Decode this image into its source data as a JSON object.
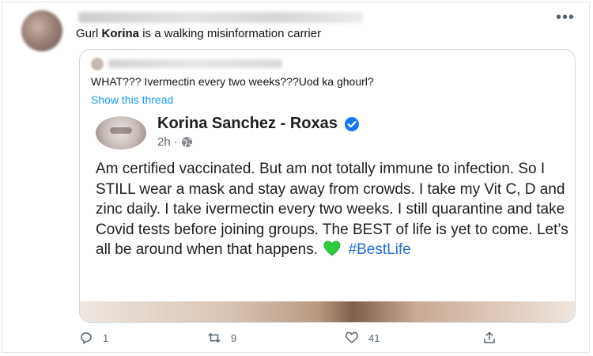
{
  "tweet": {
    "text_prefix": "Gurl ",
    "text_bold": "Korina",
    "text_suffix": " is a walking misinformation carrier"
  },
  "quote": {
    "text": "WHAT??? Ivermectin every two weeks???Uod ka ghourl?",
    "show_thread": "Show this thread"
  },
  "fb_post": {
    "author": "Korina Sanchez - Roxas",
    "time": "2h",
    "separator": "·",
    "body": "Am certified vaccinated. But am not totally immune to infection. So I STILL wear a mask and stay away from crowds. I take my Vit C, D and zinc daily. I take ivermectin every two weeks. I still quarantine and take Covid tests before joining groups. The BEST of life is yet to come. Let’s all be around when that happens.",
    "hashtag": "#BestLife",
    "icons": {
      "verified": "verified-badge-icon",
      "audience": "globe-icon",
      "emoji": "green-heart-icon"
    },
    "colors": {
      "verified": "#1877f2",
      "heart": "#2ecc40",
      "hashtag": "#216fdb"
    }
  },
  "actions": {
    "reply_count": "1",
    "retweet_count": "9",
    "like_count": "41"
  },
  "colors": {
    "link": "#1d9bf0",
    "muted": "#536471"
  }
}
